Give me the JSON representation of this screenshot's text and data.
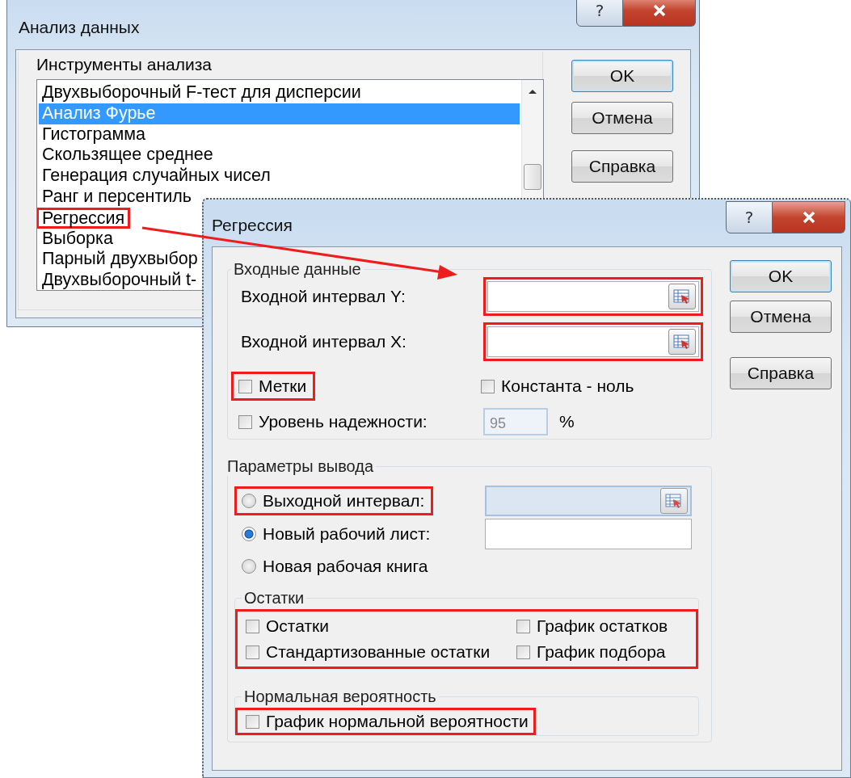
{
  "analysis_dialog": {
    "title": "Анализ данных",
    "help_glyph": "?",
    "group_label": "Инструменты анализа",
    "tools": [
      {
        "label": "Двухвыборочный F-тест для дисперсии",
        "selected": false,
        "highlighted": false
      },
      {
        "label": "Анализ Фурье",
        "selected": true,
        "highlighted": false
      },
      {
        "label": "Гистограмма",
        "selected": false,
        "highlighted": false
      },
      {
        "label": "Скользящее среднее",
        "selected": false,
        "highlighted": false
      },
      {
        "label": "Генерация случайных чисел",
        "selected": false,
        "highlighted": false
      },
      {
        "label": "Ранг и персентиль",
        "selected": false,
        "highlighted": false
      },
      {
        "label": "Регрессия",
        "selected": false,
        "highlighted": true
      },
      {
        "label": "Выборка",
        "selected": false,
        "highlighted": false
      },
      {
        "label": "Парный двухвыбор",
        "selected": false,
        "highlighted": false
      },
      {
        "label": "Двухвыборочный t-",
        "selected": false,
        "highlighted": false
      }
    ],
    "buttons": [
      {
        "label": "OK",
        "default": true
      },
      {
        "label": "Отмена",
        "default": false
      },
      {
        "label": "Справка",
        "default": false
      }
    ]
  },
  "regression_dialog": {
    "title": "Регрессия",
    "help_glyph": "?",
    "input_group": {
      "label": "Входные данные",
      "fields": [
        {
          "label": "Входной интервал Y:",
          "highlighted": true
        },
        {
          "label": "Входной интервал X:",
          "highlighted": true
        }
      ],
      "labels_option": {
        "label": "Метки",
        "checked": false,
        "highlighted": true
      },
      "constant_option": {
        "label": "Константа - ноль",
        "checked": false,
        "highlighted": false
      },
      "confidence_option": {
        "label": "Уровень надежности:",
        "checked": false,
        "highlighted": false,
        "value": "95",
        "unit": "%"
      }
    },
    "output_group": {
      "label": "Параметры вывода",
      "choices": [
        {
          "label": "Выходной интервал:",
          "selected": false,
          "highlighted": true,
          "kind": "range",
          "field_disabled": true
        },
        {
          "label": "Новый рабочий лист:",
          "selected": true,
          "highlighted": false,
          "kind": "text",
          "field_disabled": false
        },
        {
          "label": "Новая рабочая книга",
          "selected": false,
          "highlighted": false,
          "kind": "none"
        }
      ],
      "residuals": {
        "label": "Остатки",
        "highlighted": true,
        "options": [
          {
            "label": "Остатки",
            "checked": false
          },
          {
            "label": "График остатков",
            "checked": false
          },
          {
            "label": "Стандартизованные остатки",
            "checked": false
          },
          {
            "label": "График подбора",
            "checked": false
          }
        ]
      },
      "normal": {
        "label": "Нормальная вероятность",
        "highlighted": true,
        "options": [
          {
            "label": "График нормальной вероятности",
            "checked": false
          }
        ]
      }
    },
    "buttons": [
      {
        "label": "OK",
        "default": true
      },
      {
        "label": "Отмена",
        "default": false
      },
      {
        "label": "Справка",
        "default": false
      }
    ]
  }
}
